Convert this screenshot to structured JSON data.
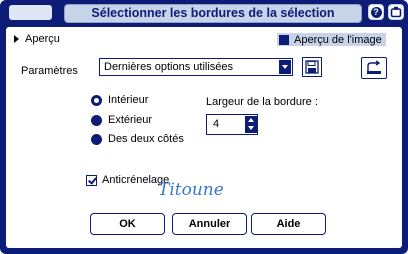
{
  "window": {
    "title": "Sélectionner les bordures de la sélection",
    "help_glyph": "?",
    "colors": {
      "frame": "#0d1d77",
      "title_pill": "#c6d3e8",
      "accent": "#0d1d77",
      "signature": "#3a78c8"
    }
  },
  "preview": {
    "label": "Aperçu",
    "image_preview_label": "Aperçu de l'image",
    "image_preview_checked": true
  },
  "parameters": {
    "label": "Paramètres",
    "preset_value": "Dernières options utilisées",
    "save_icon": "floppy-disk-icon",
    "reset_icon": "reset-icon"
  },
  "position": {
    "options": [
      {
        "label": "Intérieur",
        "selected": true
      },
      {
        "label": "Extérieur",
        "selected": false
      },
      {
        "label": "Des deux côtés",
        "selected": false
      }
    ]
  },
  "border_width": {
    "label": "Largeur de la bordure :",
    "value": "4"
  },
  "antialias": {
    "label": "Anticrénelage",
    "checked": true
  },
  "signature": "Titoune",
  "buttons": {
    "ok": "OK",
    "cancel": "Annuler",
    "help": "Aide"
  }
}
